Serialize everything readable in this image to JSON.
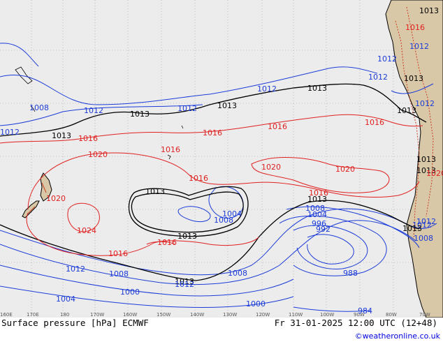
{
  "colors": {
    "ocean": "#ececec",
    "land": "#d8c8a8",
    "grid": "#9a9a9a",
    "coast": "#000000",
    "low": "#1c3cd8",
    "base": "#000000",
    "high": "#e02020"
  },
  "footer": {
    "title": "Surface pressure [hPa] ECMWF",
    "valid": "Fr 31-01-2025 12:00 UTC (12+48)",
    "credit": "©weatheronline.co.uk"
  },
  "longitude_ticks": [
    "160E",
    "170E",
    "180",
    "170W",
    "160W",
    "150W",
    "140W",
    "130W",
    "120W",
    "110W",
    "100W",
    "90W",
    "80W",
    "70W"
  ],
  "isobar_labels": [
    {
      "text": "1013",
      "kind": "base"
    },
    {
      "text": "1016",
      "kind": "high"
    },
    {
      "text": "1012",
      "kind": "low"
    },
    {
      "text": "1012",
      "kind": "low"
    },
    {
      "text": "1012",
      "kind": "low"
    },
    {
      "text": "1013",
      "kind": "base"
    },
    {
      "text": "1012",
      "kind": "low"
    },
    {
      "text": "1008",
      "kind": "low"
    },
    {
      "text": "1012",
      "kind": "low"
    },
    {
      "text": "1012",
      "kind": "low"
    },
    {
      "text": "1013",
      "kind": "base"
    },
    {
      "text": "1012",
      "kind": "low"
    },
    {
      "text": "1013",
      "kind": "base"
    },
    {
      "text": "1012",
      "kind": "low"
    },
    {
      "text": "1013",
      "kind": "base"
    },
    {
      "text": "1012",
      "kind": "low"
    },
    {
      "text": "1013",
      "kind": "base"
    },
    {
      "text": "1013",
      "kind": "base"
    },
    {
      "text": "1013",
      "kind": "base"
    },
    {
      "text": "1016",
      "kind": "high"
    },
    {
      "text": "1016",
      "kind": "high"
    },
    {
      "text": "1016",
      "kind": "high"
    },
    {
      "text": "1016",
      "kind": "high"
    },
    {
      "text": "1020",
      "kind": "high"
    },
    {
      "text": "1016",
      "kind": "high"
    },
    {
      "text": "1020",
      "kind": "high"
    },
    {
      "text": "1020",
      "kind": "high"
    },
    {
      "text": "1020",
      "kind": "high"
    },
    {
      "text": "1016",
      "kind": "high"
    },
    {
      "text": "1013",
      "kind": "base"
    },
    {
      "text": "1013",
      "kind": "base"
    },
    {
      "text": "1008",
      "kind": "low"
    },
    {
      "text": "1004",
      "kind": "low"
    },
    {
      "text": "1013",
      "kind": "base"
    },
    {
      "text": "1013",
      "kind": "base"
    },
    {
      "text": "1008",
      "kind": "low"
    },
    {
      "text": "1004",
      "kind": "low"
    },
    {
      "text": "996",
      "kind": "low"
    },
    {
      "text": "992",
      "kind": "low"
    },
    {
      "text": "1016",
      "kind": "high"
    },
    {
      "text": "1013",
      "kind": "base"
    },
    {
      "text": "1012",
      "kind": "low"
    },
    {
      "text": "1008",
      "kind": "low"
    },
    {
      "text": "1020",
      "kind": "high"
    },
    {
      "text": "1024",
      "kind": "high"
    },
    {
      "text": "1016",
      "kind": "high"
    },
    {
      "text": "1016",
      "kind": "high"
    },
    {
      "text": "1013",
      "kind": "base"
    },
    {
      "text": "1012",
      "kind": "low"
    },
    {
      "text": "1012",
      "kind": "low"
    },
    {
      "text": "1008",
      "kind": "low"
    },
    {
      "text": "1008",
      "kind": "low"
    },
    {
      "text": "1000",
      "kind": "low"
    },
    {
      "text": "1004",
      "kind": "low"
    },
    {
      "text": "1000",
      "kind": "low"
    },
    {
      "text": "988",
      "kind": "low"
    },
    {
      "text": "984",
      "kind": "low"
    }
  ]
}
